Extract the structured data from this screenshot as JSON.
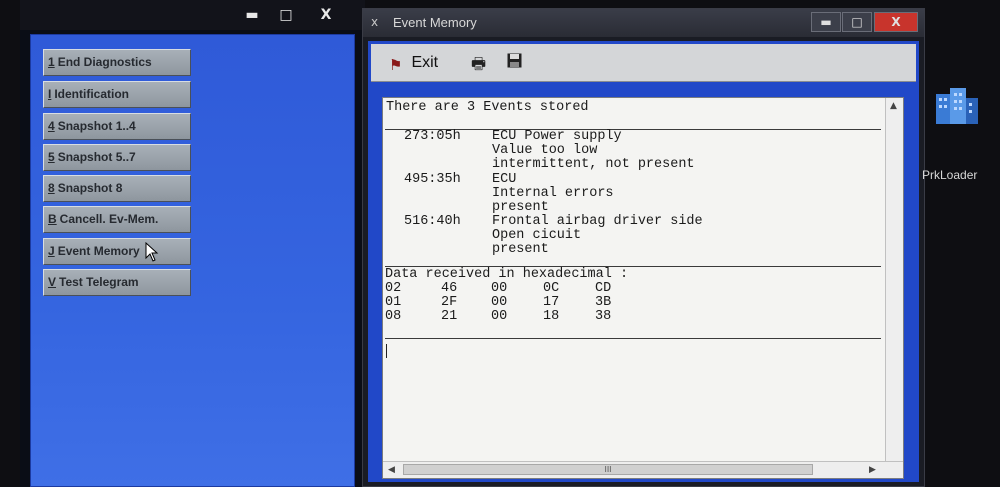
{
  "left_window": {
    "controls": {
      "minimize": "▬",
      "maximize": "□",
      "close": "X"
    },
    "menu": [
      {
        "key": "1",
        "label": "End Diagnostics"
      },
      {
        "key": "I",
        "label": "Identification"
      },
      {
        "key": "4",
        "label": "Snapshot 1..4"
      },
      {
        "key": "5",
        "label": "Snapshot 5..7"
      },
      {
        "key": "8",
        "label": "Snapshot 8"
      },
      {
        "key": "B",
        "label": "Cancell. Ev-Mem."
      },
      {
        "key": "J",
        "label": "Event Memory"
      },
      {
        "key": "V",
        "label": "Test Telegram"
      }
    ]
  },
  "event_window": {
    "title": "Event Memory",
    "controls": {
      "minimize": "▬",
      "maximize": "□",
      "close": "X"
    },
    "toolbar": {
      "exit_label": "Exit",
      "exit_icon": "exit-icon",
      "print_icon": "printer-icon",
      "save_icon": "floppy-icon"
    },
    "header_text": "There are 3 Events stored",
    "events": [
      {
        "time": "273:05h",
        "lines": [
          "ECU Power supply",
          "Value too low",
          "intermittent, not present"
        ]
      },
      {
        "time": "495:35h",
        "lines": [
          "ECU",
          "Internal errors",
          "present"
        ]
      },
      {
        "time": "516:40h",
        "lines": [
          "Frontal airbag driver side",
          "Open cicuit",
          "present"
        ]
      }
    ],
    "hex_header": "Data received in hexadecimal :",
    "hex_rows": [
      [
        "02",
        "46",
        "00",
        "0C",
        "CD"
      ],
      [
        "01",
        "2F",
        "00",
        "17",
        "3B"
      ],
      [
        "08",
        "21",
        "00",
        "18",
        "38"
      ]
    ],
    "scroll_thumb_label": "III"
  },
  "desktop": {
    "icon_label": "PrkLoader",
    "icon_name": "building-icon"
  }
}
